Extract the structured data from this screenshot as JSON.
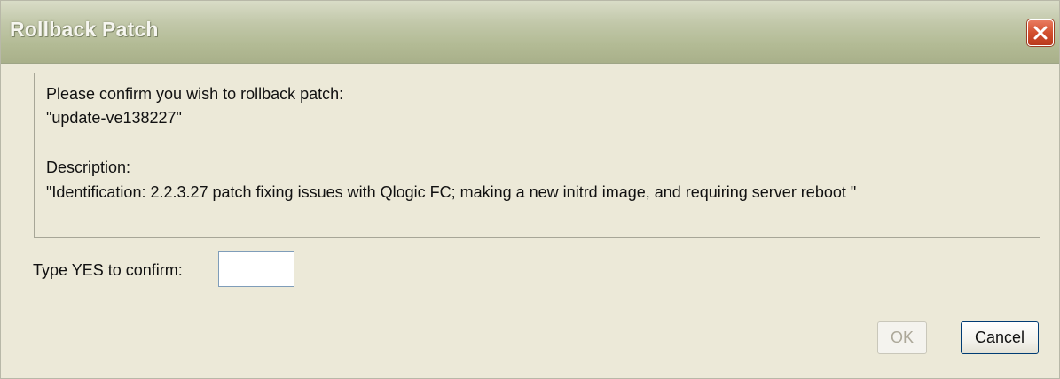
{
  "window": {
    "title": "Rollback Patch"
  },
  "info": {
    "prompt": "Please confirm you wish to rollback patch:",
    "patch_name": "\"update-ve138227\"",
    "description_label": "Description:",
    "description": "\"Identification: 2.2.3.27 patch fixing issues with Qlogic FC; making a new initrd image, and requiring server reboot \""
  },
  "confirm": {
    "label": "Type YES to confirm:",
    "value": ""
  },
  "buttons": {
    "ok": {
      "mnemonic": "O",
      "rest": "K",
      "enabled": false
    },
    "cancel": {
      "mnemonic": "C",
      "rest": "ancel",
      "enabled": true
    }
  },
  "icons": {
    "close": "close-icon"
  },
  "colors": {
    "title_bar": "#b3bb95",
    "close_button": "#d2502f",
    "dialog_background": "#ece9d8",
    "input_border": "#7f9db9",
    "disabled_text": "#aca899"
  }
}
